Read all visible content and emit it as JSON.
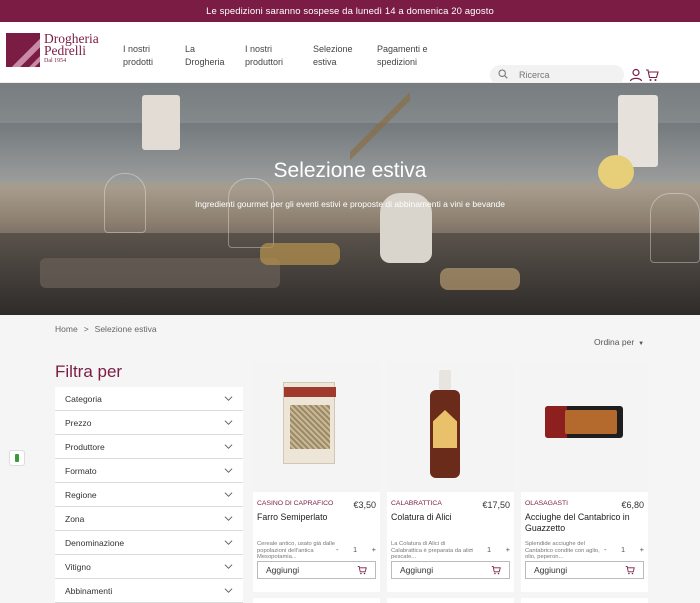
{
  "announcement": "Le spedizioni saranno sospese da lunedì 14 a domenica 20 agosto",
  "logo": {
    "line1": "Drogheria",
    "line2": "Pedrelli",
    "line3": "Dal 1954"
  },
  "nav": [
    {
      "label": "I nostri prodotti"
    },
    {
      "label": "La Drogheria"
    },
    {
      "label": "I nostri produttori"
    },
    {
      "label": "Selezione estiva"
    },
    {
      "label": "Pagamenti e spedizioni"
    }
  ],
  "search": {
    "placeholder": "Ricerca"
  },
  "hero": {
    "title": "Selezione estiva",
    "subtitle": "Ingredienti gourmet per gli eventi estivi e proposte di abbinamenti a vini e bevande"
  },
  "breadcrumb": {
    "home": "Home",
    "separator": ">",
    "current": "Selezione estiva"
  },
  "sort": {
    "label": "Ordina per"
  },
  "filters": {
    "title": "Filtra per",
    "items": [
      "Categoria",
      "Prezzo",
      "Produttore",
      "Formato",
      "Regione",
      "Zona",
      "Denominazione",
      "Vitigno",
      "Abbinamenti"
    ]
  },
  "products": [
    {
      "brand": "CASINO DI CAPRAFICO",
      "price": "€3,50",
      "name": "Farro Semiperlato",
      "desc": "Cereale antico, usato già dalle popolazioni dell'antica Mesopotamia...",
      "qty": "1",
      "add_label": "Aggiungi"
    },
    {
      "brand": "CALABRATTICA",
      "price": "€17,50",
      "name": "Colatura di Alici",
      "desc": "La Colatura di Alici di Calabrattica è preparata da alici pescate...",
      "qty": "1",
      "add_label": "Aggiungi"
    },
    {
      "brand": "OLASAGASTI",
      "price": "€6,80",
      "name": "Acciughe del Cantabrico in Guazzetto",
      "desc": "Splendide acciughe del Cantabrico condite con aglio, olio, peperon...",
      "qty": "1",
      "add_label": "Aggiungi"
    }
  ],
  "colors": {
    "brand": "#7a1c44",
    "background": "#f6f5f5"
  }
}
